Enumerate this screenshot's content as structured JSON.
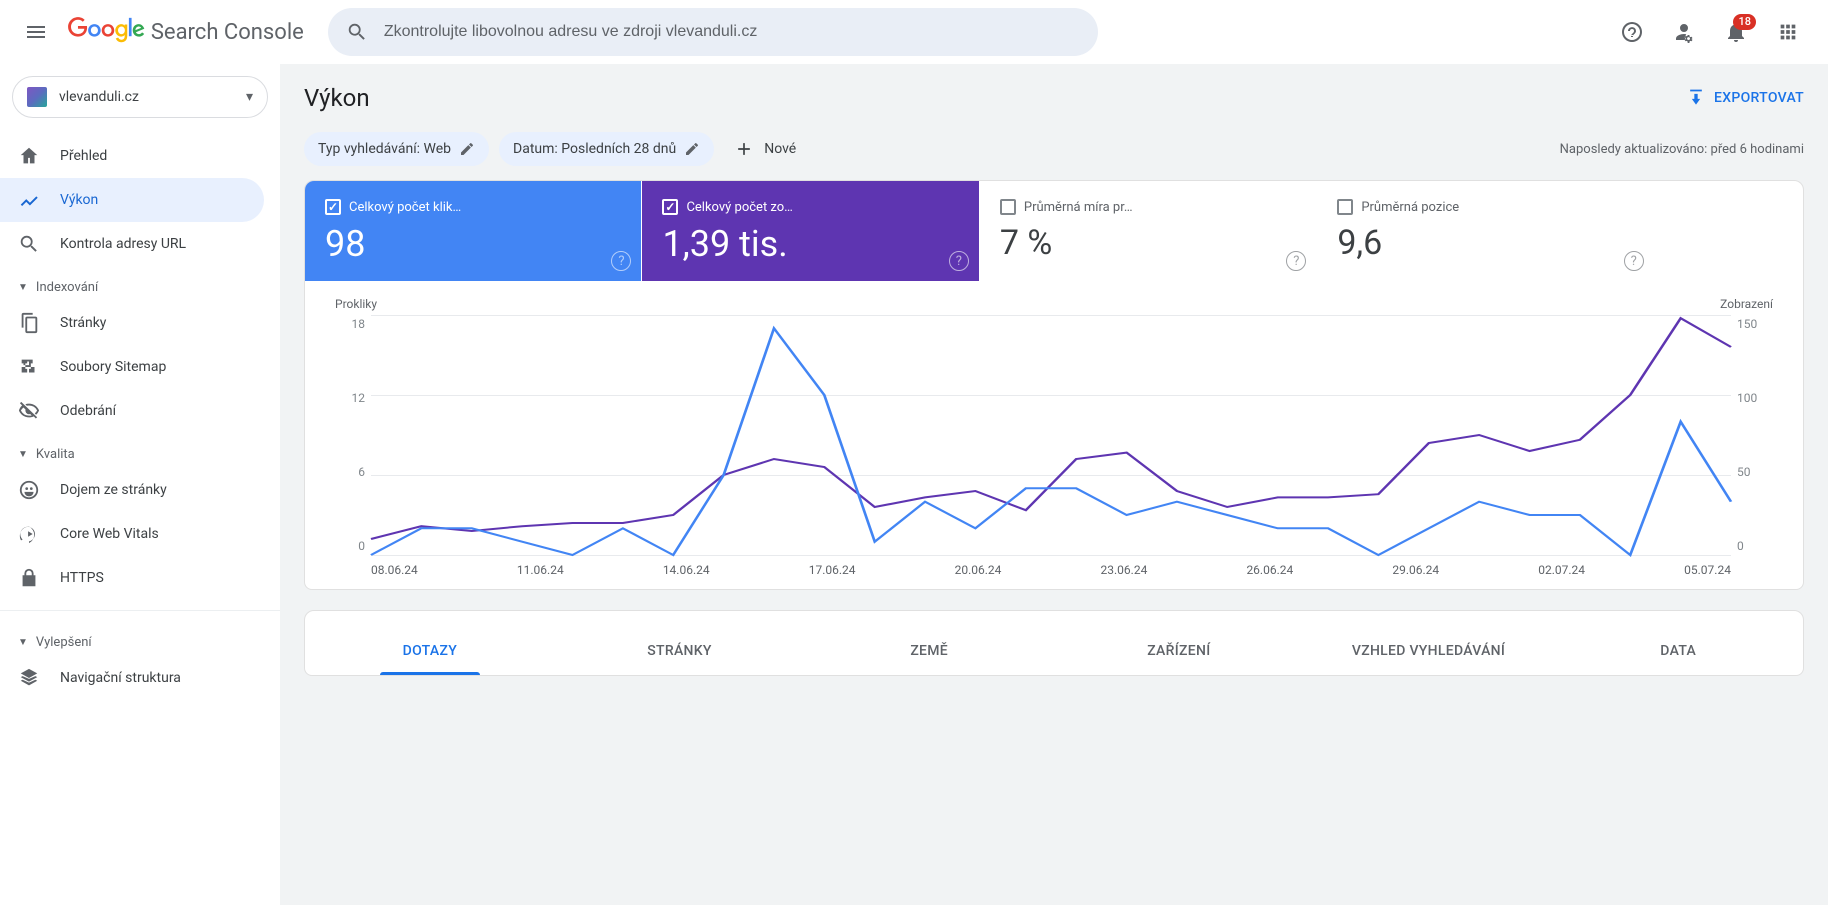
{
  "header": {
    "product_name": "Search Console",
    "search_placeholder": "Zkontrolujte libovolnou adresu ve zdroji vlevanduli.cz",
    "notif_count": "18"
  },
  "sidebar": {
    "property": "vlevanduli.cz",
    "items": {
      "overview": "Přehled",
      "performance": "Výkon",
      "url_inspect": "Kontrola adresy URL"
    },
    "sections": {
      "indexing": "Indexování",
      "quality": "Kvalita",
      "enhancements": "Vylepšení"
    },
    "indexing": {
      "pages": "Stránky",
      "sitemaps": "Soubory Sitemap",
      "removals": "Odebrání"
    },
    "quality": {
      "page_experience": "Dojem ze stránky",
      "cwv": "Core Web Vitals",
      "https": "HTTPS"
    },
    "enhancements": {
      "nav_structure": "Navigační struktura"
    }
  },
  "page": {
    "title": "Výkon",
    "export_label": "EXPORTOVAT"
  },
  "filters": {
    "search_type_label": "Typ vyhledávání: Web",
    "date_label": "Datum: Posledních 28 dnů",
    "add_label": "Nové",
    "updated_label": "Naposledy aktualizováno: před 6 hodinami"
  },
  "metrics": {
    "clicks": {
      "label": "Celkový počet klik…",
      "value": "98"
    },
    "impressions": {
      "label": "Celkový počet zo…",
      "value": "1,39 tis."
    },
    "ctr": {
      "label": "Průměrná míra pr…",
      "value": "7 %"
    },
    "position": {
      "label": "Průměrná pozice",
      "value": "9,6"
    }
  },
  "chart": {
    "left_title": "Prokliky",
    "right_title": "Zobrazení",
    "y_left_ticks": [
      "18",
      "12",
      "6",
      "0"
    ],
    "y_right_ticks": [
      "150",
      "100",
      "50",
      "0"
    ],
    "x_ticks": [
      "08.06.24",
      "11.06.24",
      "14.06.24",
      "17.06.24",
      "20.06.24",
      "23.06.24",
      "26.06.24",
      "29.06.24",
      "02.07.24",
      "05.07.24"
    ]
  },
  "tabs": {
    "queries": "DOTAZY",
    "pages": "STRÁNKY",
    "countries": "ZEMĚ",
    "devices": "ZAŘÍZENÍ",
    "search_appearance": "VZHLED VYHLEDÁVÁNÍ",
    "dates": "DATA"
  },
  "chart_data": {
    "type": "line",
    "x_dates": [
      "08.06.24",
      "09.06.24",
      "10.06.24",
      "11.06.24",
      "12.06.24",
      "13.06.24",
      "14.06.24",
      "15.06.24",
      "16.06.24",
      "17.06.24",
      "18.06.24",
      "19.06.24",
      "20.06.24",
      "21.06.24",
      "22.06.24",
      "23.06.24",
      "24.06.24",
      "25.06.24",
      "26.06.24",
      "27.06.24",
      "28.06.24",
      "29.06.24",
      "30.06.24",
      "01.07.24",
      "02.07.24",
      "03.07.24",
      "04.07.24",
      "05.07.24"
    ],
    "series": [
      {
        "name": "Prokliky",
        "color": "#4285f4",
        "axis": "left",
        "values": [
          0,
          2,
          2,
          1,
          0,
          2,
          0,
          6,
          17,
          12,
          1,
          4,
          2,
          5,
          5,
          3,
          4,
          3,
          2,
          2,
          0,
          2,
          4,
          3,
          3,
          0,
          10,
          4
        ]
      },
      {
        "name": "Zobrazení",
        "color": "#5e35b1",
        "axis": "right",
        "values": [
          10,
          18,
          15,
          18,
          20,
          20,
          25,
          50,
          60,
          55,
          30,
          36,
          40,
          28,
          60,
          64,
          40,
          30,
          36,
          36,
          38,
          70,
          75,
          65,
          72,
          100,
          148,
          130
        ]
      }
    ],
    "y_left_range": [
      0,
      18
    ],
    "y_right_range": [
      0,
      150
    ],
    "title": "",
    "xlabel": "",
    "ylabel_left": "Prokliky",
    "ylabel_right": "Zobrazení"
  }
}
